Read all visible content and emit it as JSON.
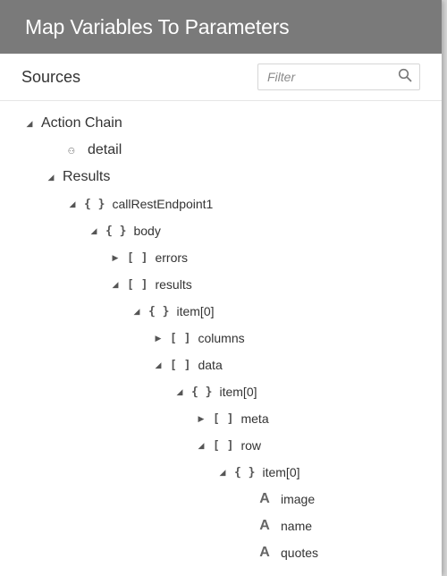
{
  "dialog": {
    "title": "Map Variables To Parameters"
  },
  "sources": {
    "title": "Sources",
    "filter_placeholder": "Filter"
  },
  "tree": [
    {
      "label": "Action Chain",
      "level": 0,
      "toggle": "expanded",
      "type": ""
    },
    {
      "label": "detail",
      "level": 1,
      "toggle": "leaf",
      "type": "variable"
    },
    {
      "label": "Results",
      "level": 1,
      "toggle": "expanded",
      "type": ""
    },
    {
      "label": "callRestEndpoint1",
      "level": 2,
      "toggle": "expanded",
      "type": "object"
    },
    {
      "label": "body",
      "level": 3,
      "toggle": "expanded",
      "type": "object"
    },
    {
      "label": "errors",
      "level": 4,
      "toggle": "collapsed",
      "type": "array"
    },
    {
      "label": "results",
      "level": 4,
      "toggle": "expanded",
      "type": "array"
    },
    {
      "label": "item[0]",
      "level": 5,
      "toggle": "expanded",
      "type": "object"
    },
    {
      "label": "columns",
      "level": 6,
      "toggle": "collapsed",
      "type": "array"
    },
    {
      "label": "data",
      "level": 6,
      "toggle": "expanded",
      "type": "array"
    },
    {
      "label": "item[0]",
      "level": 7,
      "toggle": "expanded",
      "type": "object"
    },
    {
      "label": "meta",
      "level": 8,
      "toggle": "collapsed",
      "type": "array"
    },
    {
      "label": "row",
      "level": 8,
      "toggle": "expanded",
      "type": "array"
    },
    {
      "label": "item[0]",
      "level": 9,
      "toggle": "expanded",
      "type": "object"
    },
    {
      "label": "image",
      "level": 10,
      "toggle": "leaf",
      "type": "string"
    },
    {
      "label": "name",
      "level": 10,
      "toggle": "leaf",
      "type": "string"
    },
    {
      "label": "quotes",
      "level": 10,
      "toggle": "leaf",
      "type": "string"
    }
  ]
}
